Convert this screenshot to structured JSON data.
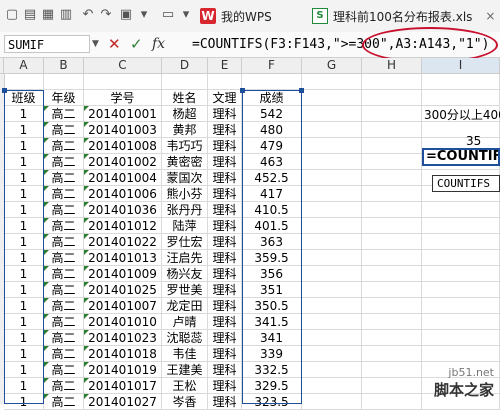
{
  "toolbar": {
    "tabs": [
      {
        "label": "我的WPS"
      },
      {
        "label": "理科前100名分布报表.xls"
      }
    ]
  },
  "formula_bar": {
    "name_box": "SUMIF",
    "fx_label": "fx",
    "formula": "=COUNTIFS(F3:F143,\">=300\",A3:A143,\"1\")"
  },
  "columns": [
    "A",
    "B",
    "C",
    "D",
    "E",
    "F",
    "G",
    "H",
    "I"
  ],
  "headers": {
    "a": "班级",
    "b": "年级",
    "c": "学号",
    "d": "姓名",
    "e": "文理",
    "f": "成绩"
  },
  "rows": [
    {
      "a": "1",
      "b": "高二",
      "c": "201401001",
      "d": "杨超",
      "e": "理科",
      "f": "542"
    },
    {
      "a": "1",
      "b": "高二",
      "c": "201401003",
      "d": "黄邦",
      "e": "理科",
      "f": "480"
    },
    {
      "a": "1",
      "b": "高二",
      "c": "201401008",
      "d": "韦巧巧",
      "e": "理科",
      "f": "479"
    },
    {
      "a": "1",
      "b": "高二",
      "c": "201401002",
      "d": "黄密密",
      "e": "理科",
      "f": "463"
    },
    {
      "a": "1",
      "b": "高二",
      "c": "201401004",
      "d": "蒙国次",
      "e": "理科",
      "f": "452.5"
    },
    {
      "a": "1",
      "b": "高二",
      "c": "201401006",
      "d": "熊小芬",
      "e": "理科",
      "f": "417"
    },
    {
      "a": "1",
      "b": "高二",
      "c": "201401036",
      "d": "张丹丹",
      "e": "理科",
      "f": "410.5"
    },
    {
      "a": "1",
      "b": "高二",
      "c": "201401012",
      "d": "陆萍",
      "e": "理科",
      "f": "401.5"
    },
    {
      "a": "1",
      "b": "高二",
      "c": "201401022",
      "d": "罗仕宏",
      "e": "理科",
      "f": "363"
    },
    {
      "a": "1",
      "b": "高二",
      "c": "201401013",
      "d": "汪启先",
      "e": "理科",
      "f": "359.5"
    },
    {
      "a": "1",
      "b": "高二",
      "c": "201401009",
      "d": "杨兴友",
      "e": "理科",
      "f": "356"
    },
    {
      "a": "1",
      "b": "高二",
      "c": "201401025",
      "d": "罗世美",
      "e": "理科",
      "f": "351"
    },
    {
      "a": "1",
      "b": "高二",
      "c": "201401007",
      "d": "龙定田",
      "e": "理科",
      "f": "350.5"
    },
    {
      "a": "1",
      "b": "高二",
      "c": "201401010",
      "d": "卢晴",
      "e": "理科",
      "f": "341.5"
    },
    {
      "a": "1",
      "b": "高二",
      "c": "201401023",
      "d": "沈聪蕊",
      "e": "理科",
      "f": "341"
    },
    {
      "a": "1",
      "b": "高二",
      "c": "201401018",
      "d": "韦佳",
      "e": "理科",
      "f": "339"
    },
    {
      "a": "1",
      "b": "高二",
      "c": "201401019",
      "d": "王建美",
      "e": "理科",
      "f": "332.5"
    },
    {
      "a": "1",
      "b": "高二",
      "c": "201401017",
      "d": "王松",
      "e": "理科",
      "f": "329.5"
    },
    {
      "a": "1",
      "b": "高二",
      "c": "201401027",
      "d": "岑香",
      "e": "理科",
      "f": "323.5"
    }
  ],
  "side": {
    "label": "300分以上400",
    "value": "35",
    "editing": "=COUNTIFS(",
    "tooltip": "COUNTIFS ("
  },
  "watermark": {
    "site": "jb51.net",
    "name": "脚本之家"
  }
}
